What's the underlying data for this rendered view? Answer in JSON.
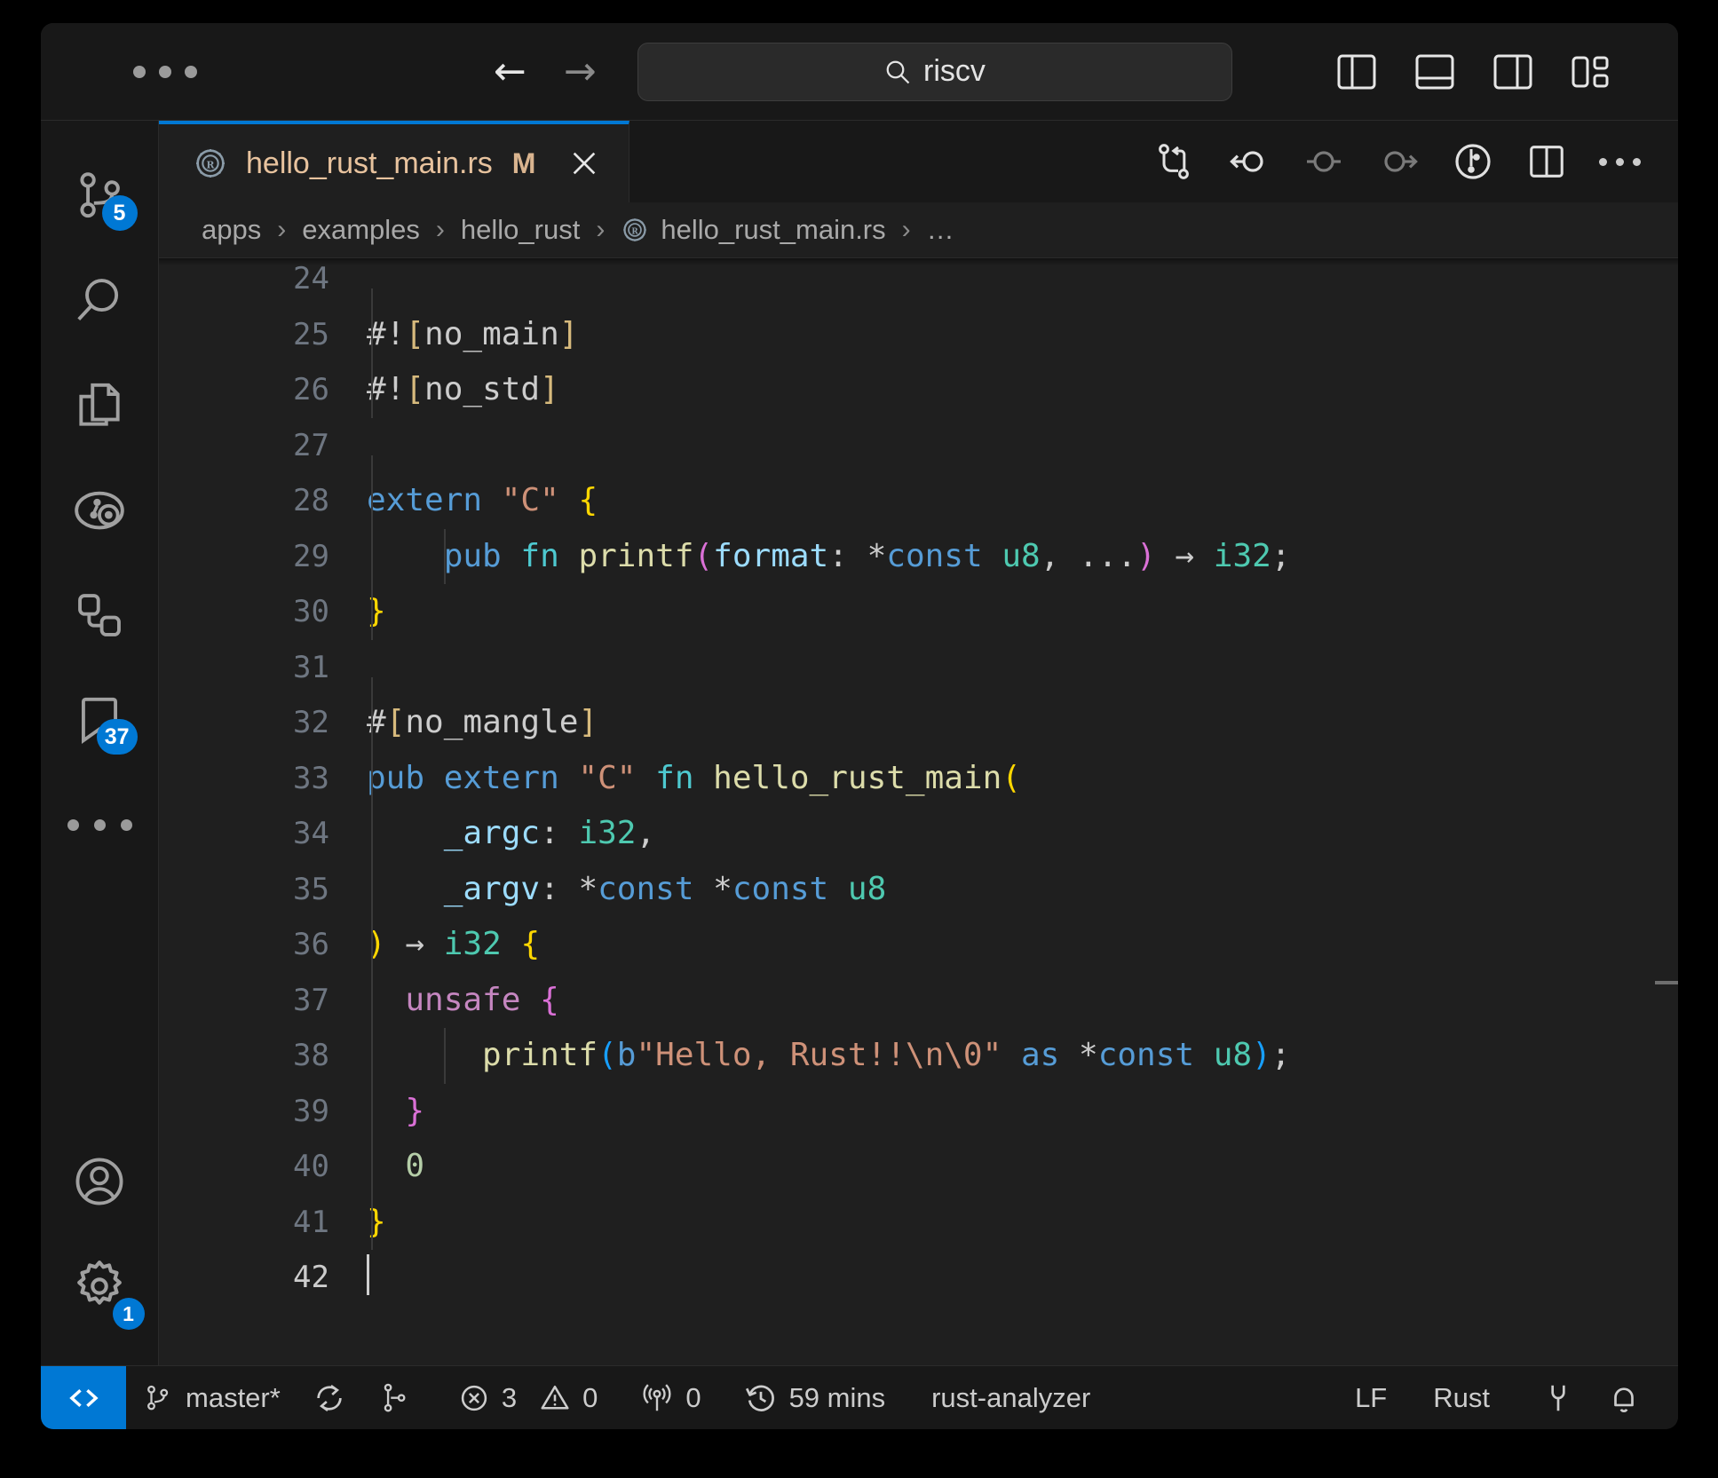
{
  "titlebar": {
    "menu_dots": "•••",
    "back_arrow": "←",
    "forward_arrow": "→",
    "search": {
      "icon": "search-icon",
      "value": "riscv",
      "placeholder": "Search"
    },
    "layout_buttons": [
      {
        "name": "toggle-primary-sidebar",
        "label": "Toggle Primary Side Bar"
      },
      {
        "name": "toggle-panel",
        "label": "Toggle Panel"
      },
      {
        "name": "toggle-secondary-sidebar",
        "label": "Toggle Secondary Side Bar"
      },
      {
        "name": "customize-layout",
        "label": "Customize Layout"
      }
    ]
  },
  "activitybar": {
    "items": [
      {
        "name": "source-control",
        "icon": "source-control-icon",
        "badge": "5"
      },
      {
        "name": "search",
        "icon": "search-icon",
        "badge": ""
      },
      {
        "name": "explorer-copy",
        "icon": "copy-files-icon",
        "badge": ""
      },
      {
        "name": "testing",
        "icon": "test-beaker-icon",
        "badge": ""
      },
      {
        "name": "extensions",
        "icon": "extensions-icon",
        "badge": ""
      },
      {
        "name": "bookmarks",
        "icon": "bookmark-icon",
        "badge": "37"
      },
      {
        "name": "more-views",
        "icon": "ellipsis-icon",
        "badge": ""
      }
    ],
    "bottom_items": [
      {
        "name": "accounts",
        "icon": "account-icon",
        "badge": ""
      },
      {
        "name": "manage-settings",
        "icon": "gear-icon",
        "badge": "1"
      }
    ]
  },
  "editor": {
    "tab": {
      "icon": "rust-icon",
      "label": "hello_rust_main.rs",
      "modified_badge": "M",
      "close_icon": "close-icon"
    },
    "actions": [
      {
        "name": "open-changes",
        "icon": "compare-changes-icon"
      },
      {
        "name": "previous-change",
        "icon": "arrow-circle-left-icon"
      },
      {
        "name": "current-change",
        "icon": "circle-dash-icon"
      },
      {
        "name": "next-change",
        "icon": "arrow-circle-right-icon"
      },
      {
        "name": "git-history",
        "icon": "git-commit-clock-icon"
      },
      {
        "name": "split-editor-right",
        "icon": "split-editor-icon"
      },
      {
        "name": "more-actions",
        "icon": "ellipsis-icon"
      }
    ],
    "breadcrumbs": [
      {
        "label": "apps",
        "icon": ""
      },
      {
        "label": "examples",
        "icon": ""
      },
      {
        "label": "hello_rust",
        "icon": ""
      },
      {
        "label": "hello_rust_main.rs",
        "icon": "rust-icon"
      },
      {
        "label": "…",
        "icon": ""
      }
    ],
    "breadcrumb_separator": "›",
    "lines": [
      {
        "num": "24",
        "tokens": []
      },
      {
        "num": "25",
        "tokens": [
          {
            "t": "#!",
            "c": "t-def"
          },
          {
            "t": "[",
            "c": "t-attr"
          },
          {
            "t": "no_main",
            "c": "t-def"
          },
          {
            "t": "]",
            "c": "t-attr"
          }
        ]
      },
      {
        "num": "26",
        "tokens": [
          {
            "t": "#!",
            "c": "t-def"
          },
          {
            "t": "[",
            "c": "t-attr"
          },
          {
            "t": "no_std",
            "c": "t-def"
          },
          {
            "t": "]",
            "c": "t-attr"
          }
        ]
      },
      {
        "num": "27",
        "tokens": []
      },
      {
        "num": "28",
        "tokens": [
          {
            "t": "extern ",
            "c": "t-kw"
          },
          {
            "t": "\"C\"",
            "c": "t-str"
          },
          {
            "t": " ",
            "c": "t-def"
          },
          {
            "t": "{",
            "c": "t-b1"
          }
        ]
      },
      {
        "num": "29",
        "tokens": [
          {
            "t": "    ",
            "c": "t-def"
          },
          {
            "t": "pub ",
            "c": "t-kw"
          },
          {
            "t": "fn ",
            "c": "t-fnkw"
          },
          {
            "t": "printf",
            "c": "t-fn"
          },
          {
            "t": "(",
            "c": "t-b2"
          },
          {
            "t": "format",
            "c": "t-var"
          },
          {
            "t": ": ",
            "c": "t-def"
          },
          {
            "t": "*",
            "c": "t-def"
          },
          {
            "t": "const ",
            "c": "t-kw"
          },
          {
            "t": "u8",
            "c": "t-type"
          },
          {
            "t": ", ",
            "c": "t-def"
          },
          {
            "t": "...",
            "c": "t-def"
          },
          {
            "t": ")",
            "c": "t-b2"
          },
          {
            "t": " → ",
            "c": "t-arrow"
          },
          {
            "t": "i32",
            "c": "t-type"
          },
          {
            "t": ";",
            "c": "t-def"
          }
        ]
      },
      {
        "num": "30",
        "tokens": [
          {
            "t": "}",
            "c": "t-b1"
          }
        ]
      },
      {
        "num": "31",
        "tokens": []
      },
      {
        "num": "32",
        "tokens": [
          {
            "t": "#",
            "c": "t-def"
          },
          {
            "t": "[",
            "c": "t-attr"
          },
          {
            "t": "no_mangle",
            "c": "t-def"
          },
          {
            "t": "]",
            "c": "t-attr"
          }
        ]
      },
      {
        "num": "33",
        "tokens": [
          {
            "t": "pub ",
            "c": "t-kw"
          },
          {
            "t": "extern ",
            "c": "t-kw"
          },
          {
            "t": "\"C\"",
            "c": "t-str"
          },
          {
            "t": " ",
            "c": "t-def"
          },
          {
            "t": "fn ",
            "c": "t-fnkw"
          },
          {
            "t": "hello_rust_main",
            "c": "t-fn"
          },
          {
            "t": "(",
            "c": "t-b1"
          }
        ]
      },
      {
        "num": "34",
        "tokens": [
          {
            "t": "    ",
            "c": "t-def"
          },
          {
            "t": "_argc",
            "c": "t-var"
          },
          {
            "t": ": ",
            "c": "t-def"
          },
          {
            "t": "i32",
            "c": "t-type"
          },
          {
            "t": ",",
            "c": "t-def"
          }
        ]
      },
      {
        "num": "35",
        "tokens": [
          {
            "t": "    ",
            "c": "t-def"
          },
          {
            "t": "_argv",
            "c": "t-var"
          },
          {
            "t": ": ",
            "c": "t-def"
          },
          {
            "t": "*",
            "c": "t-def"
          },
          {
            "t": "const ",
            "c": "t-kw"
          },
          {
            "t": "*",
            "c": "t-def"
          },
          {
            "t": "const ",
            "c": "t-kw"
          },
          {
            "t": "u8",
            "c": "t-type"
          }
        ]
      },
      {
        "num": "36",
        "tokens": [
          {
            "t": ")",
            "c": "t-b1"
          },
          {
            "t": " → ",
            "c": "t-arrow"
          },
          {
            "t": "i32",
            "c": "t-type"
          },
          {
            "t": " ",
            "c": "t-def"
          },
          {
            "t": "{",
            "c": "t-b1"
          }
        ]
      },
      {
        "num": "37",
        "tokens": [
          {
            "t": "  ",
            "c": "t-def"
          },
          {
            "t": "unsafe",
            "c": "t-ctl"
          },
          {
            "t": " ",
            "c": "t-def"
          },
          {
            "t": "{",
            "c": "t-b2"
          }
        ]
      },
      {
        "num": "38",
        "tokens": [
          {
            "t": "      ",
            "c": "t-def"
          },
          {
            "t": "printf",
            "c": "t-fn"
          },
          {
            "t": "(",
            "c": "t-b3"
          },
          {
            "t": "b",
            "c": "t-kw"
          },
          {
            "t": "\"Hello, Rust!!\\n\\0\"",
            "c": "t-str"
          },
          {
            "t": " ",
            "c": "t-def"
          },
          {
            "t": "as ",
            "c": "t-kw"
          },
          {
            "t": "*",
            "c": "t-def"
          },
          {
            "t": "const ",
            "c": "t-kw"
          },
          {
            "t": "u8",
            "c": "t-type"
          },
          {
            "t": ")",
            "c": "t-b3"
          },
          {
            "t": ";",
            "c": "t-def"
          }
        ]
      },
      {
        "num": "39",
        "tokens": [
          {
            "t": "  ",
            "c": "t-def"
          },
          {
            "t": "}",
            "c": "t-b2"
          }
        ]
      },
      {
        "num": "40",
        "tokens": [
          {
            "t": "  ",
            "c": "t-def"
          },
          {
            "t": "0",
            "c": "t-num"
          }
        ]
      },
      {
        "num": "41",
        "tokens": [
          {
            "t": "}",
            "c": "t-b1"
          }
        ]
      },
      {
        "num": "42",
        "tokens": [],
        "cursor": true,
        "current": true
      }
    ]
  },
  "statusbar": {
    "remote_icon": "remote-window-icon",
    "branch": {
      "icon": "source-control-icon",
      "label": "master*"
    },
    "sync_icon": "sync-icon",
    "branch_compare_icon": "git-branch-compare-icon",
    "errors": {
      "icon": "error-circle-icon",
      "count": "3"
    },
    "warnings": {
      "icon": "warning-triangle-icon",
      "count": "0"
    },
    "ports": {
      "icon": "radio-tower-icon",
      "count": "0"
    },
    "timer": {
      "icon": "history-clock-icon",
      "label": "59 mins"
    },
    "language_server": "rust-analyzer",
    "eol": "LF",
    "language": "Rust",
    "plug_icon": "plug-icon",
    "bell_icon": "bell-icon"
  },
  "colors": {
    "accent": "#0078d4",
    "titlebar_bg": "#181818",
    "editor_bg": "#1f1f1f",
    "badge_bg": "#0078d4",
    "tab_label": "#e8c39e"
  }
}
